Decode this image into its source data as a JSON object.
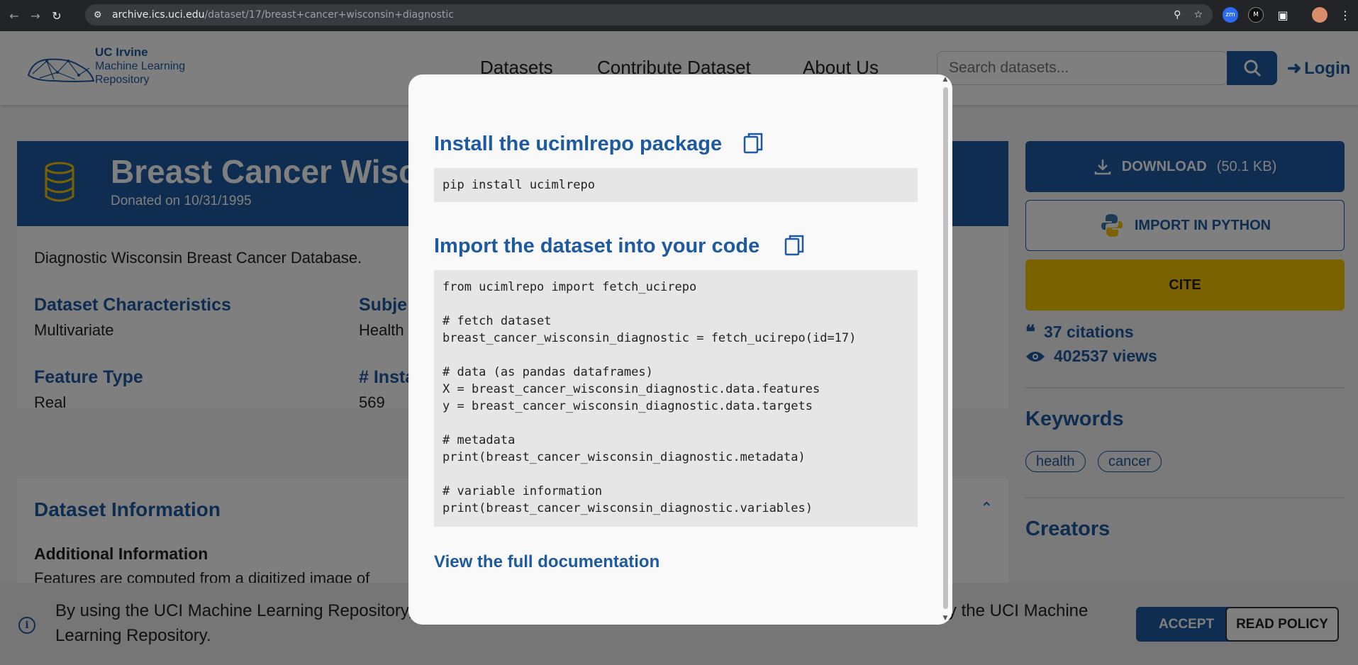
{
  "browser": {
    "url_domain": "archive.ics.uci.edu",
    "url_path": "/dataset/17/breast+cancer+wisconsin+diagnostic",
    "extensions": [
      "zm",
      "M"
    ]
  },
  "header": {
    "logo_line1": "UC Irvine",
    "logo_line2": "Machine Learning",
    "logo_line3": "Repository",
    "nav": [
      "Datasets",
      "Contribute Dataset",
      "About Us"
    ],
    "search_placeholder": "Search datasets...",
    "login_label": "Login"
  },
  "dataset": {
    "title": "Breast Cancer Wiscon",
    "donated": "Donated on 10/31/1995",
    "description": "Diagnostic Wisconsin Breast Cancer Database.",
    "characteristics": [
      {
        "label": "Dataset Characteristics",
        "value": "Multivariate"
      },
      {
        "label": "Subje",
        "value": "Health"
      },
      {
        "label": "Feature Type",
        "value": "Real"
      },
      {
        "label": "# Insta",
        "value": "569"
      }
    ],
    "info_title": "Dataset Information",
    "additional_title": "Additional Information",
    "additional_text": "Features are computed from a digitized image of"
  },
  "sidebar": {
    "download_label": "DOWNLOAD",
    "download_size": "(50.1 KB)",
    "import_label": "IMPORT IN PYTHON",
    "cite_label": "CITE",
    "citations": "37 citations",
    "views": "402537 views",
    "keywords_title": "Keywords",
    "keywords": [
      "health",
      "cancer"
    ],
    "creators_title": "Creators"
  },
  "cookie": {
    "text": "By using the UCI Machine Learning Repository, you acknowledge and accept the cookies and privacy practices used by the UCI Machine Learning Repository.",
    "accept_label": "ACCEPT",
    "policy_label": "READ POLICY"
  },
  "modal": {
    "install_title": "Install the ucimlrepo package",
    "install_code": "pip install ucimlrepo",
    "import_title": "Import the dataset into your code",
    "import_code": "from ucimlrepo import fetch_ucirepo\n\n# fetch dataset\nbreast_cancer_wisconsin_diagnostic = fetch_ucirepo(id=17)\n\n# data (as pandas dataframes)\nX = breast_cancer_wisconsin_diagnostic.data.features\ny = breast_cancer_wisconsin_diagnostic.data.targets\n\n# metadata\nprint(breast_cancer_wisconsin_diagnostic.metadata)\n\n# variable information\nprint(breast_cancer_wisconsin_diagnostic.variables)",
    "doc_link": "View the full documentation"
  },
  "colors": {
    "brand_blue": "#1e5aa0",
    "cite_yellow": "#f5c400"
  }
}
